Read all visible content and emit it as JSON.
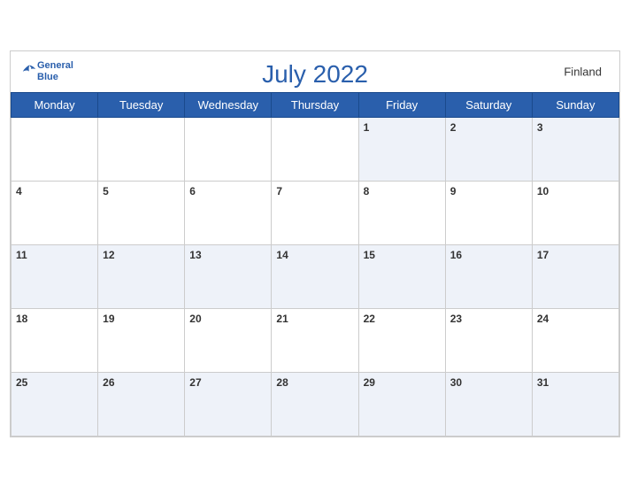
{
  "header": {
    "title": "July 2022",
    "country": "Finland",
    "logo_line1": "General",
    "logo_line2": "Blue"
  },
  "weekdays": [
    "Monday",
    "Tuesday",
    "Wednesday",
    "Thursday",
    "Friday",
    "Saturday",
    "Sunday"
  ],
  "weeks": [
    [
      null,
      null,
      null,
      null,
      1,
      2,
      3
    ],
    [
      4,
      5,
      6,
      7,
      8,
      9,
      10
    ],
    [
      11,
      12,
      13,
      14,
      15,
      16,
      17
    ],
    [
      18,
      19,
      20,
      21,
      22,
      23,
      24
    ],
    [
      25,
      26,
      27,
      28,
      29,
      30,
      31
    ]
  ]
}
